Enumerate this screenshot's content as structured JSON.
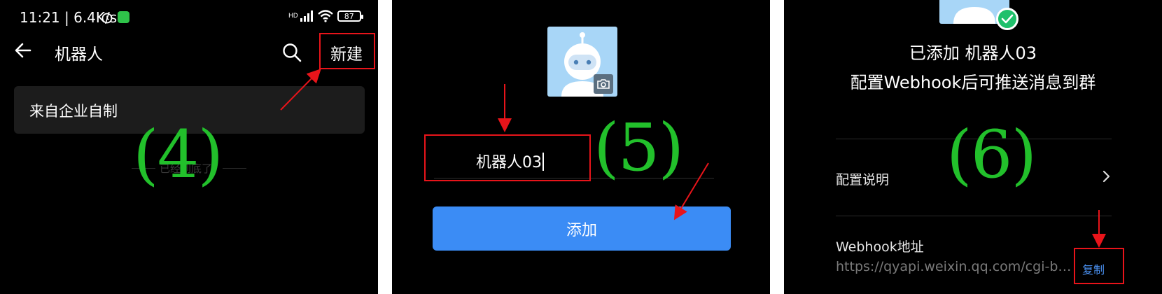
{
  "colors": {
    "accent_blue": "#3b8cf5",
    "annotation_red": "#e8141a",
    "step_green": "#22c02b",
    "success_green": "#1fc06b"
  },
  "panel1": {
    "status": {
      "time": "11:21 | 6.4K/s",
      "network": "HD",
      "battery": "87"
    },
    "icons": {
      "back": "back-arrow-icon",
      "search": "search-icon",
      "alarm": "alarm-icon",
      "wifi": "wifi-icon",
      "signal": "signal-icon"
    },
    "nav_title": "机器人",
    "new_label": "新建",
    "list_items": [
      "来自企业自制"
    ],
    "bottom_hint": "已经到底了",
    "step": "(4)"
  },
  "panel2": {
    "icons": {
      "avatar": "robot-avatar-icon",
      "camera": "camera-icon"
    },
    "name_value": "机器人03",
    "add_label": "添加",
    "step": "(5)"
  },
  "panel3": {
    "icons": {
      "check": "check-icon",
      "chevron": "chevron-right-icon"
    },
    "added_title": "已添加 机器人03",
    "added_subtitle": "配置Webhook后可推送消息到群",
    "config_label": "配置说明",
    "webhook_label": "Webhook地址",
    "webhook_url": "https://qyapi.weixin.qq.com/cgi-bi…",
    "copy_label": "复制",
    "step": "(6)"
  }
}
